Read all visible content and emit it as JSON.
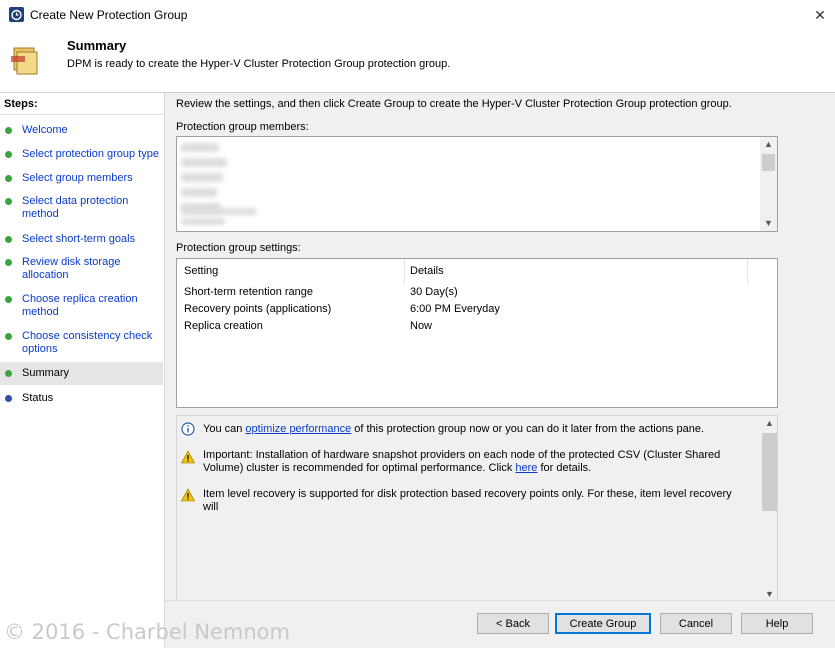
{
  "window": {
    "title": "Create New Protection Group",
    "close_glyph": "✕"
  },
  "header": {
    "title": "Summary",
    "subtitle": "DPM is ready to create the Hyper-V Cluster Protection Group protection group."
  },
  "sidebar": {
    "heading": "Steps:",
    "items": [
      {
        "label": "Welcome",
        "state": "done"
      },
      {
        "label": "Select protection group type",
        "state": "done"
      },
      {
        "label": "Select group members",
        "state": "done"
      },
      {
        "label": "Select data protection method",
        "state": "done"
      },
      {
        "label": "Select short-term goals",
        "state": "done"
      },
      {
        "label": "Review disk storage allocation",
        "state": "done"
      },
      {
        "label": "Choose replica creation method",
        "state": "done"
      },
      {
        "label": "Choose consistency check options",
        "state": "done"
      },
      {
        "label": "Summary",
        "state": "current"
      },
      {
        "label": "Status",
        "state": "pending"
      }
    ]
  },
  "main": {
    "intro": "Review the settings, and then click Create Group to create the Hyper-V Cluster Protection Group protection group.",
    "members_label": "Protection group members:",
    "settings_label": "Protection group settings:",
    "settings_table": {
      "headers": [
        "Setting",
        "Details"
      ],
      "rows": [
        [
          "Short-term retention range",
          "30 Day(s)"
        ],
        [
          "Recovery points (applications)",
          "6:00 PM Everyday"
        ],
        [
          "Replica creation",
          "Now"
        ]
      ]
    },
    "notes": {
      "info_prefix": "You can ",
      "info_link": "optimize performance",
      "info_suffix": " of this protection group now or you can do it later from the actions pane.",
      "warning1_prefix": "Important: Installation of hardware snapshot providers on each node of the protected CSV (Cluster Shared Volume) cluster is recommended for optimal performance. Click ",
      "warning1_link": "here",
      "warning1_suffix": " for details.",
      "warning2": "Item level recovery is supported for disk protection based recovery points only. For these, item level recovery will"
    }
  },
  "footer": {
    "back": "< Back",
    "create": "Create Group",
    "cancel": "Cancel",
    "help": "Help"
  },
  "watermark": "© 2016 - Charbel Nemnom",
  "colors": {
    "done_dot": "#3aa53a",
    "pending_dot": "#2f4fa8",
    "link": "#0a3bc8"
  }
}
